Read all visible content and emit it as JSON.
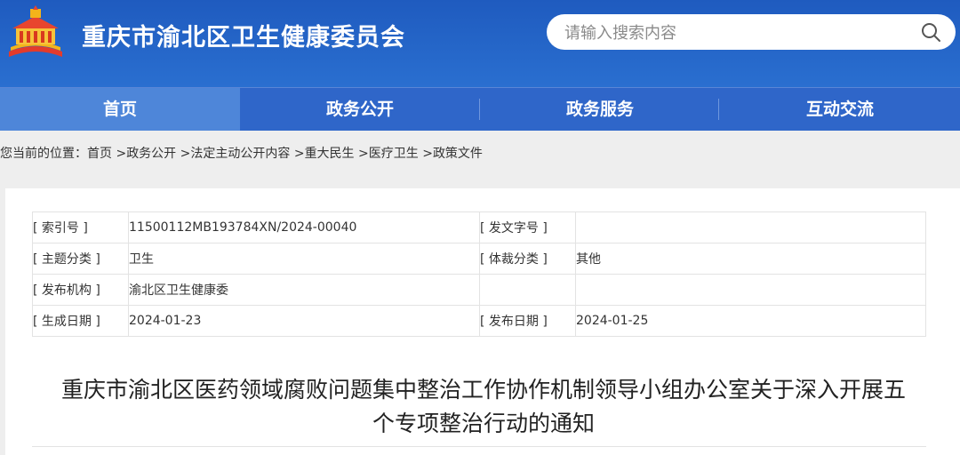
{
  "header": {
    "site_title": "重庆市渝北区卫生健康委员会",
    "search_placeholder": "请输入搜索内容"
  },
  "nav": {
    "items": [
      {
        "label": "首页"
      },
      {
        "label": "政务公开"
      },
      {
        "label": "政务服务"
      },
      {
        "label": "互动交流"
      }
    ]
  },
  "breadcrumb": {
    "prefix": "您当前的位置：",
    "items": [
      "首页",
      "政务公开",
      "法定主动公开内容",
      "重大民生",
      "医疗卫生",
      "政策文件"
    ],
    "separator": " >"
  },
  "meta": {
    "rows": [
      [
        "[ 索引号 ]",
        "11500112MB193784XN/2024-00040",
        "[ 发文字号 ]",
        ""
      ],
      [
        "[ 主题分类 ]",
        "卫生",
        "[ 体裁分类 ]",
        "其他"
      ],
      [
        "[ 发布机构 ]",
        "渝北区卫生健康委",
        "",
        ""
      ],
      [
        "[ 生成日期 ]",
        "2024-01-23",
        "[ 发布日期 ]",
        "2024-01-25"
      ]
    ]
  },
  "document": {
    "title_line1": "重庆市渝北区医药领域腐败问题集中整治工作协作机制领导小组办公室关于深入开展五",
    "title_line2": "个专项整治行动的通知"
  },
  "colors": {
    "header_bg": "#2a6fd0",
    "nav_bg": "#2f66c9",
    "nav_active_bg": "#4e86d9"
  }
}
